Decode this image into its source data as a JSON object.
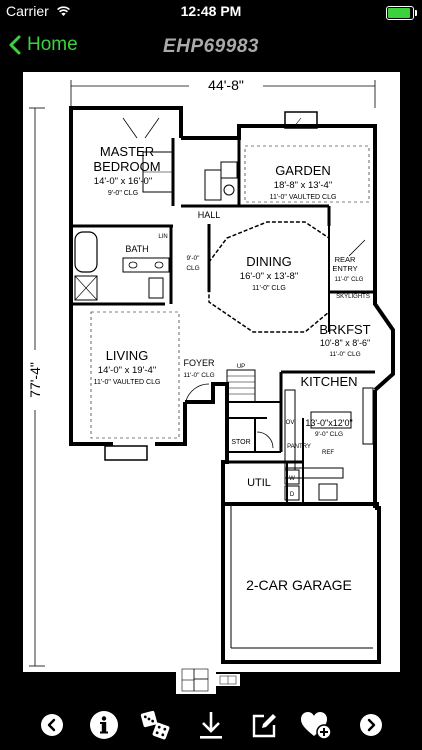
{
  "status_bar": {
    "carrier": "Carrier",
    "time": "12:48 PM",
    "battery_level": 1.0
  },
  "navbar": {
    "back_label": "Home",
    "title": "EHP69983"
  },
  "colors": {
    "accent": "#3bd23b",
    "background": "#000000",
    "title": "#aaaaaa"
  },
  "floor_plan": {
    "width_dimension": "44'-8\"",
    "depth_dimension": "77'-4\"",
    "rooms": {
      "master_name_1": "MASTER",
      "master_name_2": "BEDROOM",
      "master_size": "14'-0\" x 16'-0\"",
      "master_clg": "9'-0\" CLG",
      "garden_name": "GARDEN",
      "garden_size": "18'-8\" x 13'-4\"",
      "garden_clg": "11'-0\" VAULTED CLG",
      "hall": "HALL",
      "bath": "BATH",
      "lin": "LIN",
      "bath_clg_1": "9'-0\"",
      "bath_clg_2": "CLG",
      "dining_name": "DINING",
      "dining_size": "16'-0\" x 13'-8\"",
      "dining_clg": "11'-0\" CLG",
      "rear_1": "REAR",
      "rear_2": "ENTRY",
      "rear_3": "11'-0\" CLG",
      "skylights": "SKYLIGHTS",
      "brkfst_name": "BRKFST",
      "brkfst_size": "10'-8\" x 8'-6\"",
      "brkfst_clg": "11'-0\" CLG",
      "living_name": "LIVING",
      "living_size": "14'-0\" x 19'-4\"",
      "living_clg": "11'-0\" VAULTED CLG",
      "foyer_name": "FOYER",
      "foyer_clg": "11'-0\" CLG",
      "up": "UP",
      "kitchen_name": "KITCHEN",
      "kitchen_size": "13'-0\"x12'0\"",
      "kitchen_clg": "9'-0\" CLG",
      "ov": "OV",
      "pantry": "PANTRY",
      "ref": "REF",
      "stor": "STOR",
      "util": "UTIL",
      "w": "W",
      "d": "D",
      "garage": "2-CAR GARAGE"
    }
  },
  "toolbar": {
    "items": [
      "previous-icon",
      "info-icon",
      "dice-icon",
      "download-icon",
      "edit-icon",
      "favorite-add-icon",
      "next-icon"
    ]
  }
}
